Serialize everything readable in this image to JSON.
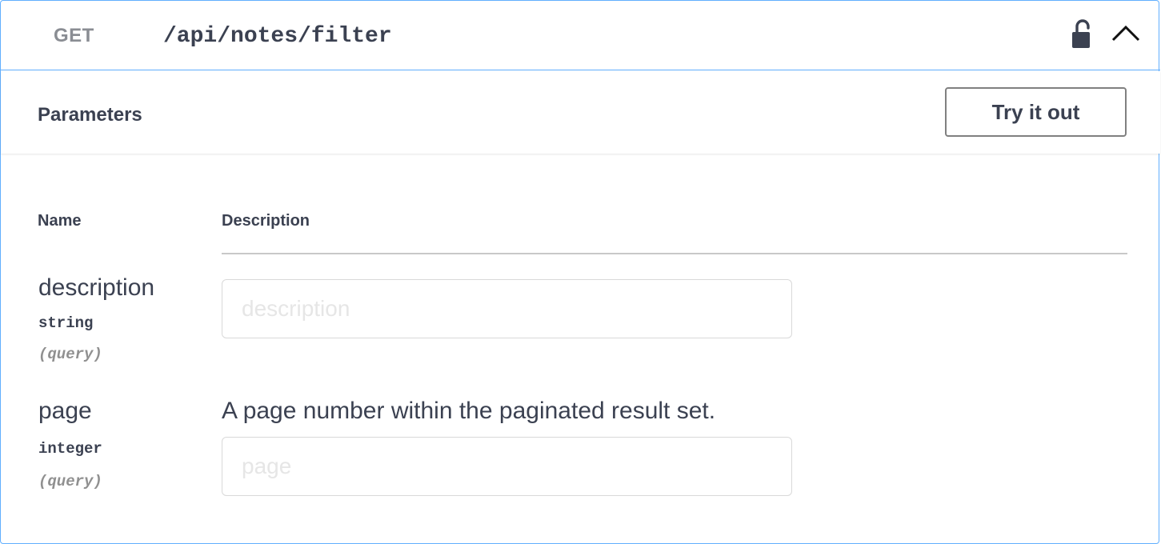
{
  "operation": {
    "method": "GET",
    "path": "/api/notes/filter"
  },
  "parameters_section": {
    "title": "Parameters",
    "try_button_label": "Try it out"
  },
  "table": {
    "col_name": "Name",
    "col_description": "Description"
  },
  "params": [
    {
      "name": "description",
      "type": "string",
      "location": "(query)",
      "description": "",
      "placeholder": "description",
      "value": ""
    },
    {
      "name": "page",
      "type": "integer",
      "location": "(query)",
      "description": "A page number within the paginated result set.",
      "placeholder": "page",
      "value": ""
    }
  ],
  "icons": {
    "lock": "unlocked-padlock-icon",
    "chevron": "chevron-up-icon"
  },
  "colors": {
    "get_accent": "#61affe",
    "text": "#3b4151",
    "method_text": "#8a8d93"
  }
}
